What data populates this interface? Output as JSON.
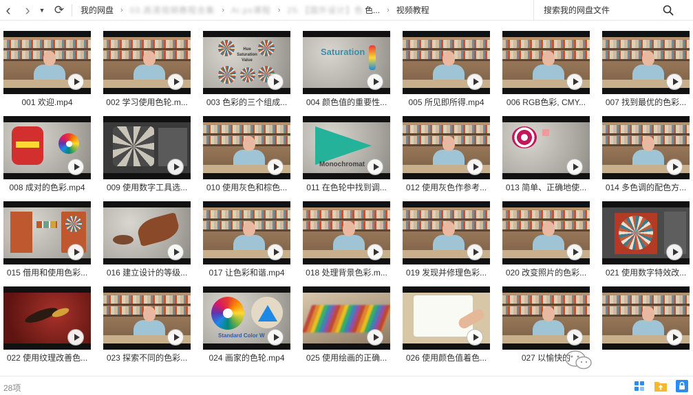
{
  "nav": {
    "back": "‹",
    "forward": "›",
    "history": "▼",
    "refresh": "⟳"
  },
  "breadcrumb": {
    "root": "我的网盘",
    "arrow": "›",
    "hidden1": "03.高清视频教程合集",
    "hidden2": "Ai.ps课程",
    "hidden3": "25.【国外设计】色",
    "partial": "色...",
    "current": "视频教程"
  },
  "search": {
    "placeholder": "搜索我的网盘文件"
  },
  "items": [
    {
      "name": "001 欢迎.mp4",
      "scene": "studio"
    },
    {
      "name": "002 学习使用色轮.m...",
      "scene": "studio"
    },
    {
      "name": "003 色彩的三个组成...",
      "scene": "mandala"
    },
    {
      "name": "004 颜色值的重要性...",
      "scene": "saturation"
    },
    {
      "name": "005 所见即所得.mp4",
      "scene": "studio"
    },
    {
      "name": "006 RGB色彩, CMY...",
      "scene": "studio"
    },
    {
      "name": "007 找到最优的色彩...",
      "scene": "studio"
    },
    {
      "name": "008 成对的色彩.mp4",
      "scene": "paired"
    },
    {
      "name": "009 使用数字工具选...",
      "scene": "digital"
    },
    {
      "name": "010 使用灰色和棕色...",
      "scene": "studio"
    },
    {
      "name": "011 在色轮中找到调...",
      "scene": "mono"
    },
    {
      "name": "012 使用灰色作参考...",
      "scene": "studio"
    },
    {
      "name": "013 简单、正确地使...",
      "scene": "simple"
    },
    {
      "name": "014 多色调的配色方...",
      "scene": "studio"
    },
    {
      "name": "015 借用和使用色彩...",
      "scene": "borrow"
    },
    {
      "name": "016 建立设计的等级...",
      "scene": "bird"
    },
    {
      "name": "017 让色彩和谐.mp4",
      "scene": "studio"
    },
    {
      "name": "018 处理背景色彩.m...",
      "scene": "studio"
    },
    {
      "name": "019 发现并修理色彩...",
      "scene": "studio"
    },
    {
      "name": "020 改变照片的色彩...",
      "scene": "studio"
    },
    {
      "name": "021 使用数字特效改...",
      "scene": "effect"
    },
    {
      "name": "022 使用纹理改善色...",
      "scene": "wasp"
    },
    {
      "name": "023 探索不同的色彩...",
      "scene": "studio"
    },
    {
      "name": "024 画家的色轮.mp4",
      "scene": "painter"
    },
    {
      "name": "025 使用绘画的正确...",
      "scene": "palette"
    },
    {
      "name": "026 使用颜色值着色...",
      "scene": "paint"
    },
    {
      "name": "027 以愉快的",
      "scene": "studio"
    },
    {
      "name": "",
      "scene": "studio"
    }
  ],
  "scene_text": {
    "saturation": "Saturation",
    "mandala_title": "Hue Saturation Value",
    "mono": "Monochromat",
    "painter": "Standard Color W"
  },
  "status": {
    "count": "28项"
  },
  "colors": {
    "folder_yellow": "#f5b82e",
    "accent_blue": "#2d8cf0"
  }
}
